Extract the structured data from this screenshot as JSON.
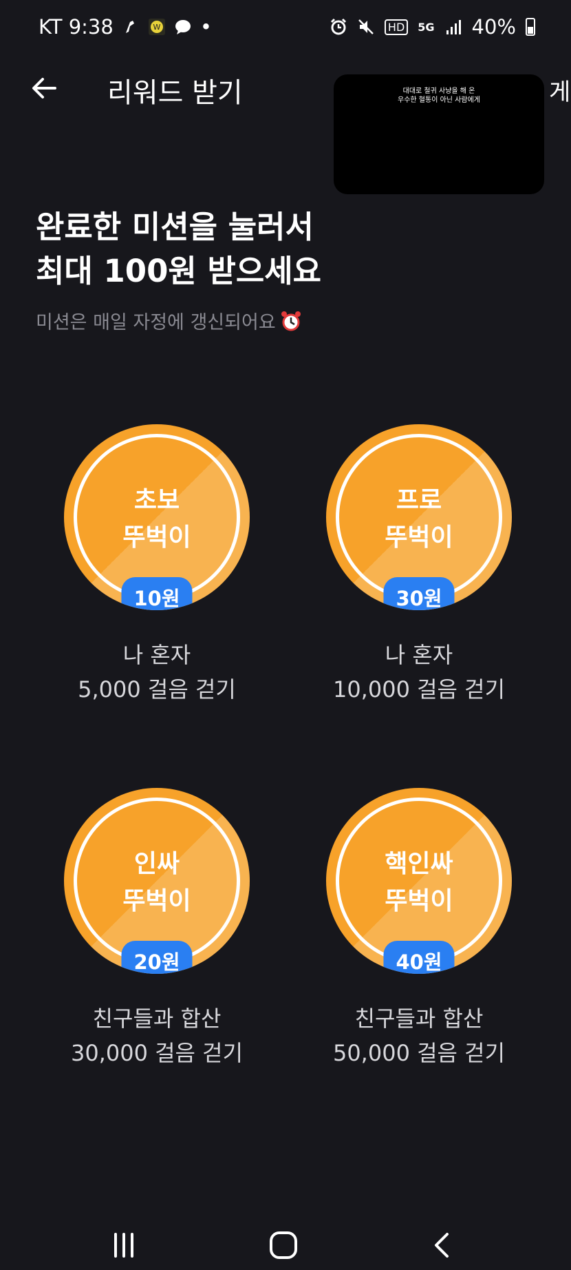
{
  "status_bar": {
    "carrier_time": "KT 9:38",
    "dot": "•",
    "network": "HD",
    "signal_type": "5G",
    "battery": "40%"
  },
  "header": {
    "title": "리워드 받기",
    "overflow_text": "게"
  },
  "video_overlay": {
    "caption_line1": "대대로 철귀 사냥을 해 온",
    "caption_line2": "우수한 혈통이 아닌 사람에게"
  },
  "headline": {
    "line1": "완료한 미션을 눌러서",
    "line2": "최대 100원 받으세요"
  },
  "subline": {
    "text": "미션은 매일 자정에 갱신되어요",
    "icon": "alarm-clock-icon"
  },
  "missions": [
    {
      "name_line1": "초보",
      "name_line2": "뚜벅이",
      "reward": "10원",
      "desc_line1": "나 혼자",
      "desc_line2": "5,000 걸음 걷기"
    },
    {
      "name_line1": "프로",
      "name_line2": "뚜벅이",
      "reward": "30원",
      "desc_line1": "나 혼자",
      "desc_line2": "10,000 걸음 걷기"
    },
    {
      "name_line1": "인싸",
      "name_line2": "뚜벅이",
      "reward": "20원",
      "desc_line1": "친구들과 합산",
      "desc_line2": "30,000 걸음 걷기"
    },
    {
      "name_line1": "핵인싸",
      "name_line2": "뚜벅이",
      "reward": "40원",
      "desc_line1": "친구들과 합산",
      "desc_line2": "50,000 걸음 걷기"
    }
  ],
  "colors": {
    "background": "#17171c",
    "medal": "#f7a22a",
    "badge": "#2a7ff2",
    "secondary_text": "#8a8a92"
  },
  "nav_bar": {
    "icons": [
      "recent-apps-icon",
      "home-icon",
      "back-nav-icon"
    ]
  }
}
